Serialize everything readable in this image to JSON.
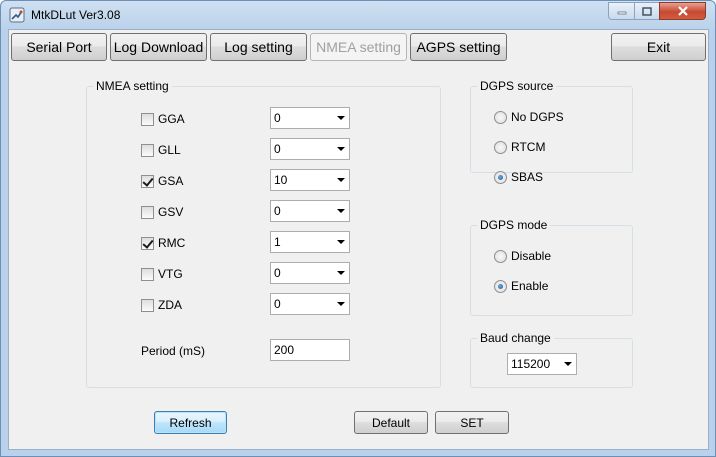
{
  "window": {
    "title": "MtkDLut Ver3.08",
    "icon": "satellite-app-icon",
    "caption_buttons": [
      "minimize-icon",
      "maximize-icon",
      "close-icon"
    ]
  },
  "tabs": [
    {
      "label": "Serial Port",
      "enabled": true
    },
    {
      "label": "Log Download",
      "enabled": true
    },
    {
      "label": "Log setting",
      "enabled": true
    },
    {
      "label": "NMEA setting",
      "enabled": false
    },
    {
      "label": "AGPS setting",
      "enabled": true
    }
  ],
  "exit_label": "Exit",
  "nmea": {
    "legend": "NMEA setting",
    "rows": [
      {
        "name": "GGA",
        "checked": false,
        "value": "0"
      },
      {
        "name": "GLL",
        "checked": false,
        "value": "0"
      },
      {
        "name": "GSA",
        "checked": true,
        "value": "10"
      },
      {
        "name": "GSV",
        "checked": false,
        "value": "0"
      },
      {
        "name": "RMC",
        "checked": true,
        "value": "1"
      },
      {
        "name": "VTG",
        "checked": false,
        "value": "0"
      },
      {
        "name": "ZDA",
        "checked": false,
        "value": "0"
      }
    ],
    "period_label": "Period (mS)",
    "period_value": "200"
  },
  "dgps_source": {
    "legend": "DGPS source",
    "options": [
      {
        "label": "No DGPS",
        "selected": false
      },
      {
        "label": "RTCM",
        "selected": false
      },
      {
        "label": "SBAS",
        "selected": true
      }
    ]
  },
  "dgps_mode": {
    "legend": "DGPS mode",
    "options": [
      {
        "label": "Disable",
        "selected": false
      },
      {
        "label": "Enable",
        "selected": true
      }
    ]
  },
  "baud": {
    "legend": "Baud change",
    "value": "115200"
  },
  "actions": {
    "refresh": "Refresh",
    "default": "Default",
    "set": "SET"
  },
  "colors": {
    "titlebar": "#b9d1ea",
    "client_bg": "#f0f0f0",
    "close_button": "#c74a32",
    "focus_blue": "#3c7fb1"
  }
}
